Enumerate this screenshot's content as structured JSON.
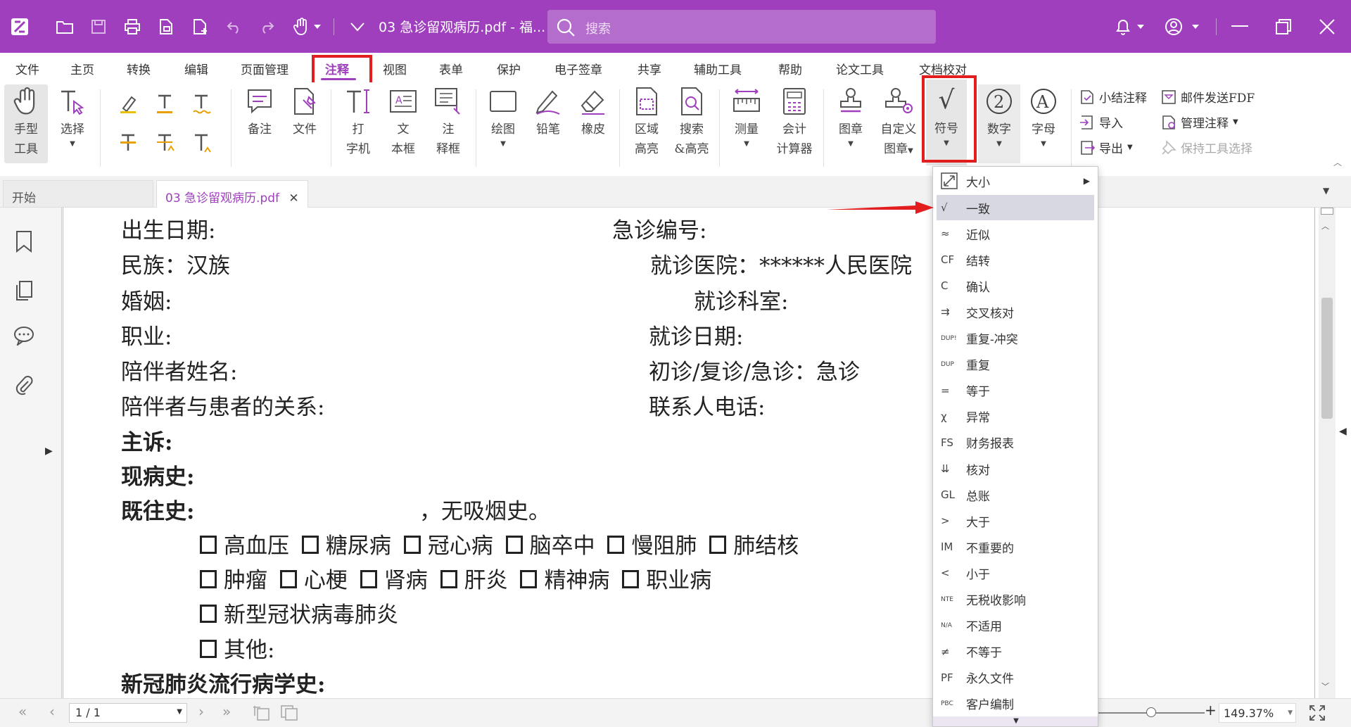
{
  "titlebar": {
    "file_title": "03 急诊留观病历.pdf - 福...",
    "search_placeholder": "搜索"
  },
  "menu": [
    "文件",
    "主页",
    "转换",
    "编辑",
    "页面管理",
    "注释",
    "视图",
    "表单",
    "保护",
    "电子签章",
    "共享",
    "辅助工具",
    "帮助",
    "论文工具",
    "文档校对"
  ],
  "active_menu": "注释",
  "ribbon": {
    "hand_tool": [
      "手型",
      "工具"
    ],
    "select": "选择",
    "note": "备注",
    "file": "文件",
    "typewriter": [
      "打",
      "字机"
    ],
    "textbox": [
      "文",
      "本框"
    ],
    "callout": [
      "注",
      "释框"
    ],
    "draw": "绘图",
    "pencil": "铅笔",
    "eraser": "橡皮",
    "area_highlight": [
      "区域",
      "高亮"
    ],
    "search_highlight": [
      "搜索",
      "&高亮"
    ],
    "measure": "测量",
    "calculator": [
      "会计",
      "计算器"
    ],
    "stamp": "图章",
    "custom_stamp": [
      "自定义",
      "图章"
    ],
    "symbol": "符号",
    "number": "数字",
    "letter": "字母",
    "summarize": "小结注释",
    "email_fdf": "邮件发送FDF",
    "import": "导入",
    "manage": "管理注释",
    "export": "导出",
    "keep_tool": "保持工具选择"
  },
  "tabs": {
    "start": "开始",
    "doc": "03 急诊留观病历.pdf"
  },
  "document": {
    "left_lines": [
      "出生日期:",
      "民族：汉族",
      "婚姻:",
      "职业:",
      "陪伴者姓名:",
      "陪伴者与患者的关系:"
    ],
    "right_lines": [
      "急诊编号:",
      "就诊医院：******人民医院",
      "就诊科室:",
      "就诊日期:",
      "初诊/复诊/急诊：急诊",
      "联系人电话:"
    ],
    "chief_complaint": "主诉:",
    "present_illness": "现病史:",
    "past_history": "既往史:",
    "past_history_note": "，无吸烟史。",
    "check_row1": [
      "高血压",
      "糖尿病",
      "冠心病",
      "脑卒中",
      "慢阻肺",
      "肺结核"
    ],
    "check_row2": [
      "肿瘤",
      "心梗",
      "肾病",
      "肝炎",
      "精神病",
      "职业病"
    ],
    "check_row3": [
      "新型冠状病毒肺炎"
    ],
    "check_row4": [
      "其他:"
    ],
    "epi_history": "新冠肺炎流行病学史:"
  },
  "dropdown": {
    "size": "大小",
    "items": [
      {
        "sym": "√",
        "label": "一致"
      },
      {
        "sym": "≈",
        "label": "近似"
      },
      {
        "sym": "CF",
        "label": "结转"
      },
      {
        "sym": "C",
        "label": "确认"
      },
      {
        "sym": "⇉",
        "label": "交叉核对"
      },
      {
        "sym": "DUP!",
        "label": "重复-冲突"
      },
      {
        "sym": "DUP",
        "label": "重复"
      },
      {
        "sym": "=",
        "label": "等于"
      },
      {
        "sym": "χ",
        "label": "异常"
      },
      {
        "sym": "FS",
        "label": "财务报表"
      },
      {
        "sym": "⇊",
        "label": "核对"
      },
      {
        "sym": "GL",
        "label": "总账"
      },
      {
        "sym": ">",
        "label": "大于"
      },
      {
        "sym": "IM",
        "label": "不重要的"
      },
      {
        "sym": "<",
        "label": "小于"
      },
      {
        "sym": "NTE",
        "label": "无税收影响"
      },
      {
        "sym": "N/A",
        "label": "不适用"
      },
      {
        "sym": "≠",
        "label": "不等于"
      },
      {
        "sym": "PF",
        "label": "永久文件"
      },
      {
        "sym": "PBC",
        "label": "客户编制"
      }
    ]
  },
  "status": {
    "page": "1 / 1",
    "zoom": "149.37%"
  },
  "colors": {
    "brand": "#9f3fbd",
    "highlight_box": "#e21e1e"
  }
}
